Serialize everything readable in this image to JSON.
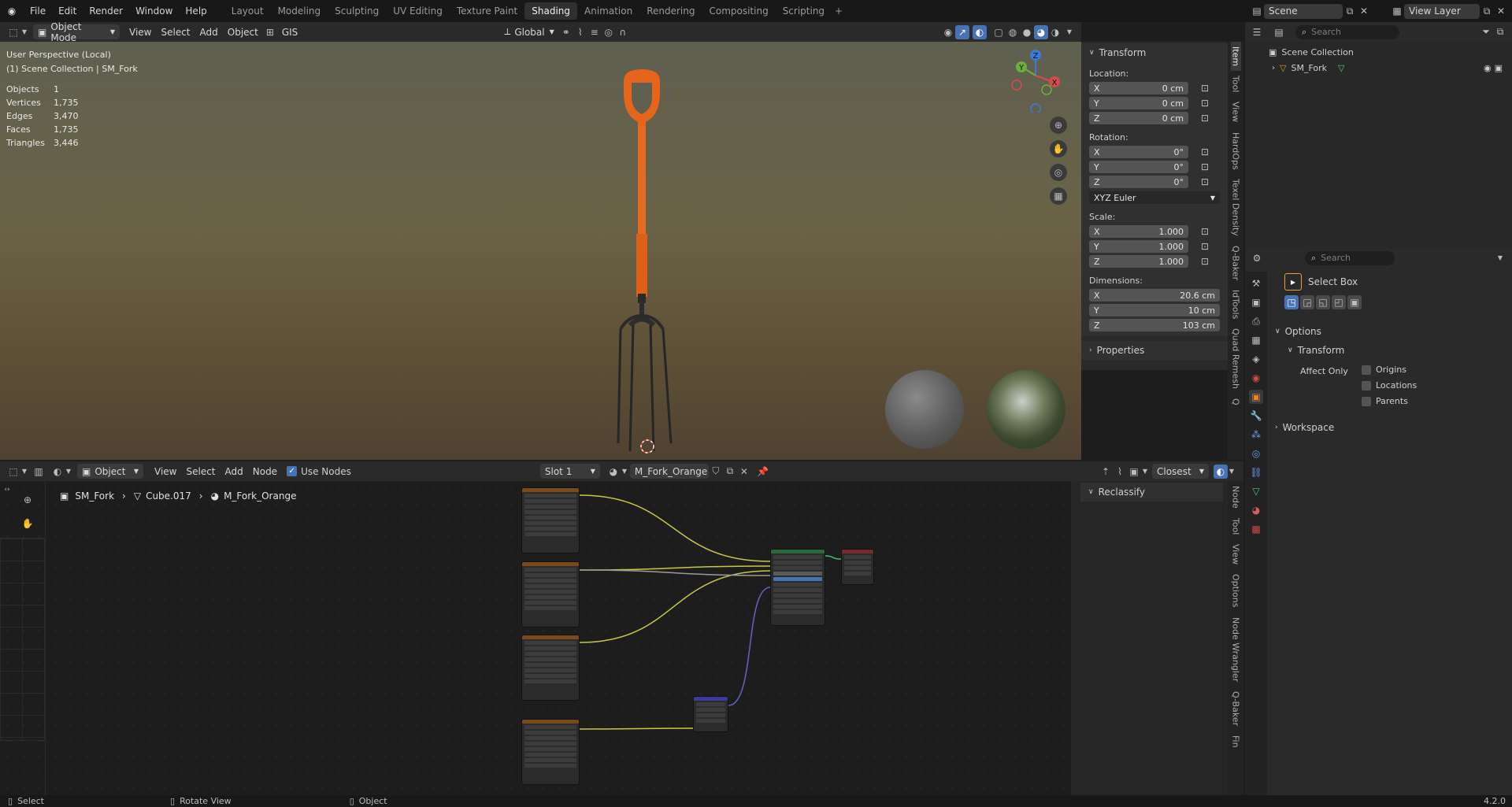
{
  "menu": [
    "File",
    "Edit",
    "Render",
    "Window",
    "Help"
  ],
  "workspaces": [
    "Layout",
    "Modeling",
    "Sculpting",
    "UV Editing",
    "Texture Paint",
    "Shading",
    "Animation",
    "Rendering",
    "Compositing",
    "Scripting"
  ],
  "active_workspace": "Shading",
  "scene": {
    "name": "Scene",
    "view_layer": "View Layer"
  },
  "viewport": {
    "mode": "Object Mode",
    "menus": [
      "View",
      "Select",
      "Add",
      "Object"
    ],
    "gis": "GIS",
    "orientation": "Global",
    "overlay_title": "User Perspective (Local)",
    "overlay_collection": "(1) Scene Collection | SM_Fork",
    "stats": [
      {
        "label": "Objects",
        "value": "1"
      },
      {
        "label": "Vertices",
        "value": "1,735"
      },
      {
        "label": "Edges",
        "value": "3,470"
      },
      {
        "label": "Faces",
        "value": "1,735"
      },
      {
        "label": "Triangles",
        "value": "3,446"
      }
    ]
  },
  "npanel": {
    "title": "Transform",
    "location_label": "Location:",
    "location": [
      {
        "axis": "X",
        "value": "0 cm"
      },
      {
        "axis": "Y",
        "value": "0 cm"
      },
      {
        "axis": "Z",
        "value": "0 cm"
      }
    ],
    "rotation_label": "Rotation:",
    "rotation": [
      {
        "axis": "X",
        "value": "0°"
      },
      {
        "axis": "Y",
        "value": "0°"
      },
      {
        "axis": "Z",
        "value": "0°"
      }
    ],
    "rotation_mode": "XYZ Euler",
    "scale_label": "Scale:",
    "scale": [
      {
        "axis": "X",
        "value": "1.000"
      },
      {
        "axis": "Y",
        "value": "1.000"
      },
      {
        "axis": "Z",
        "value": "1.000"
      }
    ],
    "dimensions_label": "Dimensions:",
    "dimensions": [
      {
        "axis": "X",
        "value": "20.6 cm"
      },
      {
        "axis": "Y",
        "value": "10 cm"
      },
      {
        "axis": "Z",
        "value": "103 cm"
      }
    ],
    "properties": "Properties",
    "tabs": [
      "Item",
      "Tool",
      "View",
      "HardOps",
      "Texel Density",
      "Q-Baker",
      "IdTools",
      "Quad Remesh",
      "Q"
    ]
  },
  "outliner": {
    "search_placeholder": "Search",
    "root": "Scene Collection",
    "item": "SM_Fork"
  },
  "properties_panel": {
    "search_placeholder": "Search",
    "tool": "Select Box",
    "options": "Options",
    "transform": "Transform",
    "affect_only": "Affect Only",
    "checks": [
      "Origins",
      "Locations",
      "Parents"
    ],
    "workspace": "Workspace"
  },
  "node_editor": {
    "type": "Object",
    "menus": [
      "View",
      "Select",
      "Add",
      "Node"
    ],
    "use_nodes": "Use Nodes",
    "slot": "Slot 1",
    "material": "M_Fork_Orange",
    "interpolation": "Closest",
    "breadcrumb": [
      "SM_Fork",
      "Cube.017",
      "M_Fork_Orange"
    ],
    "side_panel": "Reclassify",
    "tabs": [
      "Node",
      "Tool",
      "View",
      "Options",
      "Node Wrangler",
      "Q-Baker",
      "Fin"
    ]
  },
  "statusbar": {
    "select": "Select",
    "rotate": "Rotate View",
    "object": "Object",
    "version": "4.2.0"
  }
}
